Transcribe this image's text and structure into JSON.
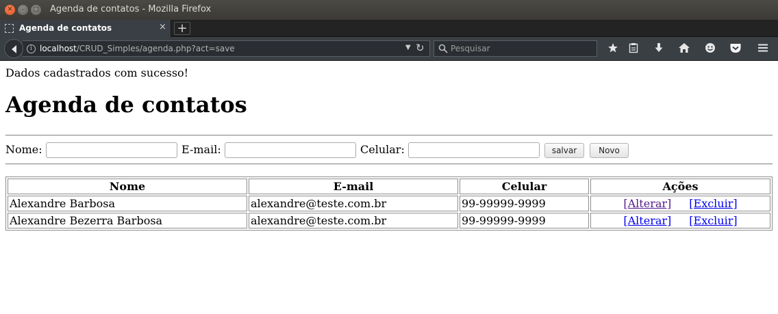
{
  "window": {
    "title": "Agenda de contatos - Mozilla Firefox",
    "close_glyph": "✕",
    "min_glyph": "–",
    "max_glyph": "□"
  },
  "tab": {
    "label": "Agenda de contatos",
    "close_glyph": "×",
    "new_tab_glyph": "+"
  },
  "nav": {
    "url_host": "localhost",
    "url_path": "/CRUD_Simples/agenda.php?act=save",
    "search_placeholder": "Pesquisar",
    "info_glyph": "i",
    "dropdown_glyph": "▼",
    "reload_glyph": "↻",
    "icons": [
      "back-arrow-icon",
      "bookmark-star-icon",
      "reading-list-icon",
      "download-icon",
      "home-icon",
      "hello-icon",
      "pocket-icon",
      "menu-icon"
    ]
  },
  "page": {
    "message": "Dados cadastrados com sucesso!",
    "title": "Agenda de contatos",
    "form": {
      "nome_label": "Nome:",
      "email_label": "E-mail:",
      "celular_label": "Celular:",
      "nome_value": "",
      "email_value": "",
      "celular_value": "",
      "save_label": "salvar",
      "new_label": "Novo"
    },
    "table": {
      "headers": [
        "Nome",
        "E-mail",
        "Celular",
        "Ações"
      ],
      "rows": [
        {
          "nome": "Alexandre Barbosa",
          "email": "alexandre@teste.com.br",
          "celular": "99-99999-9999",
          "alterar": "[Alterar]",
          "excluir": "[Excluir]"
        },
        {
          "nome": "Alexandre Bezerra Barbosa",
          "email": "alexandre@teste.com.br",
          "celular": "99-99999-9999",
          "alterar": "[Alterar]",
          "excluir": "[Excluir]"
        }
      ]
    }
  },
  "colors": {
    "link": "#0000ee",
    "visited_link": "#551a8b",
    "titlebar": "#3b3a36",
    "toolbar": "#3a3f44"
  }
}
